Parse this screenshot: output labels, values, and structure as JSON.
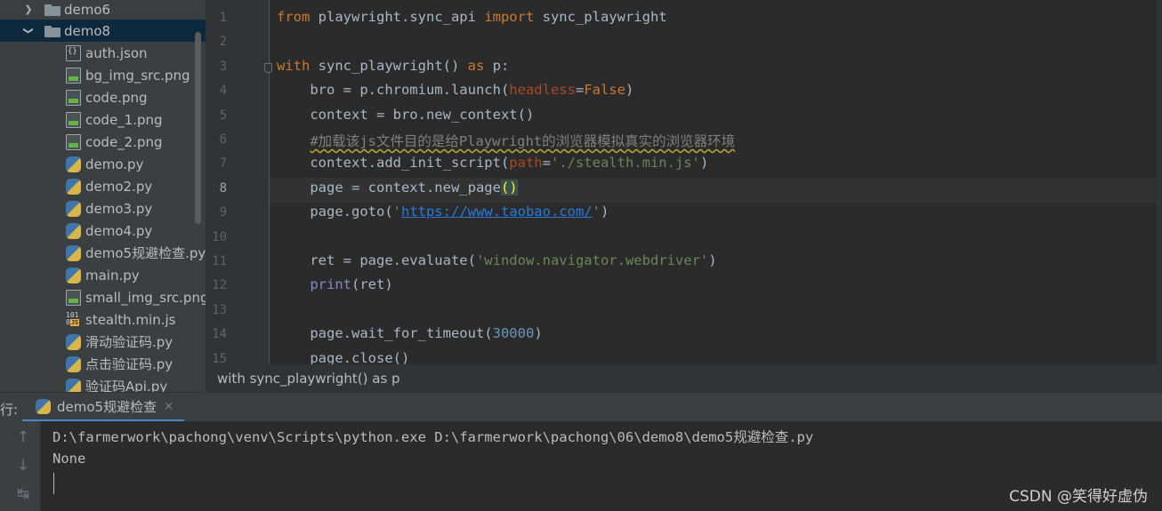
{
  "project_tree": {
    "folders": [
      {
        "name": "demo6",
        "expanded": false
      },
      {
        "name": "demo8",
        "expanded": true
      }
    ],
    "files": [
      {
        "name": "auth.json",
        "icon": "json-file-icon"
      },
      {
        "name": "bg_img_src.png",
        "icon": "image-file-icon"
      },
      {
        "name": "code.png",
        "icon": "image-file-icon"
      },
      {
        "name": "code_1.png",
        "icon": "image-file-icon"
      },
      {
        "name": "code_2.png",
        "icon": "image-file-icon"
      },
      {
        "name": "demo.py",
        "icon": "python-file-icon"
      },
      {
        "name": "demo2.py",
        "icon": "python-file-icon"
      },
      {
        "name": "demo3.py",
        "icon": "python-file-icon"
      },
      {
        "name": "demo4.py",
        "icon": "python-file-icon"
      },
      {
        "name": "demo5规避检查.py",
        "icon": "python-file-icon"
      },
      {
        "name": "main.py",
        "icon": "python-file-icon"
      },
      {
        "name": "small_img_src.png",
        "icon": "image-file-icon"
      },
      {
        "name": "stealth.min.js",
        "icon": "javascript-file-icon"
      },
      {
        "name": "滑动验证码.py",
        "icon": "python-file-icon"
      },
      {
        "name": "点击验证码.py",
        "icon": "python-file-icon"
      },
      {
        "name": "验证码Api.py",
        "icon": "python-file-icon"
      }
    ]
  },
  "editor": {
    "line_numbers": [
      "1",
      "2",
      "3",
      "4",
      "5",
      "6",
      "7",
      "8",
      "9",
      "10",
      "11",
      "12",
      "13",
      "14",
      "15"
    ],
    "current_line": "8",
    "code_lines": [
      [
        [
          "kw",
          "from "
        ],
        [
          "",
          "playwright.sync_api "
        ],
        [
          "kw",
          "import "
        ],
        [
          "",
          "sync_playwright"
        ]
      ],
      [],
      [
        [
          "kw",
          "with "
        ],
        [
          "",
          "sync_playwright() "
        ],
        [
          "kw",
          "as "
        ],
        [
          "",
          "p:"
        ]
      ],
      [
        [
          "",
          "    bro = p.chromium.launch("
        ],
        [
          "pm",
          "headless"
        ],
        [
          "",
          "="
        ],
        [
          "kw",
          "False"
        ],
        [
          "",
          ")"
        ]
      ],
      [
        [
          "",
          "    context = bro.new_context()"
        ]
      ],
      [
        [
          "",
          "    "
        ],
        [
          "cmw",
          "#加载该js文件目的是给Playwright的浏览器模拟真实的浏览器环境"
        ]
      ],
      [
        [
          "",
          "    context.add_init_script("
        ],
        [
          "pm",
          "path"
        ],
        [
          "",
          "="
        ],
        [
          "st",
          "'./stealth.min.js'"
        ],
        [
          "",
          ")"
        ]
      ],
      [
        [
          "",
          "    page = context.new_page"
        ],
        [
          "bm",
          "()"
        ]
      ],
      [
        [
          "",
          "    page.goto("
        ],
        [
          "st",
          "'"
        ],
        [
          "ur",
          "https://www.taobao.com/"
        ],
        [
          "st",
          "'"
        ],
        [
          "",
          ")"
        ]
      ],
      [],
      [
        [
          "",
          "    ret = page.evaluate("
        ],
        [
          "st",
          "'window.navigator.webdriver'"
        ],
        [
          "",
          ")"
        ]
      ],
      [
        [
          "",
          "    "
        ],
        [
          "bi",
          "print"
        ],
        [
          "",
          "(ret)"
        ]
      ],
      [],
      [
        [
          "",
          "    page.wait_for_timeout("
        ],
        [
          "nm",
          "30000"
        ],
        [
          "",
          ")"
        ]
      ],
      [
        [
          "",
          "    page.close()"
        ]
      ]
    ]
  },
  "breadcrumb": {
    "text": "with sync_playwright() as p"
  },
  "run_panel": {
    "label": "行:",
    "tab_label": "demo5规避检查",
    "close_glyph": "×",
    "output_lines": [
      "D:\\farmerwork\\pachong\\venv\\Scripts\\python.exe D:\\farmerwork\\pachong\\06\\demo8\\demo5规避检查.py",
      "None"
    ]
  },
  "watermark": "CSDN @笑得好虚伪",
  "colors": {
    "keyword": "#cc7832",
    "string": "#6a8759",
    "number": "#6897bb",
    "param": "#aa4926",
    "selection": "#0d293e"
  }
}
